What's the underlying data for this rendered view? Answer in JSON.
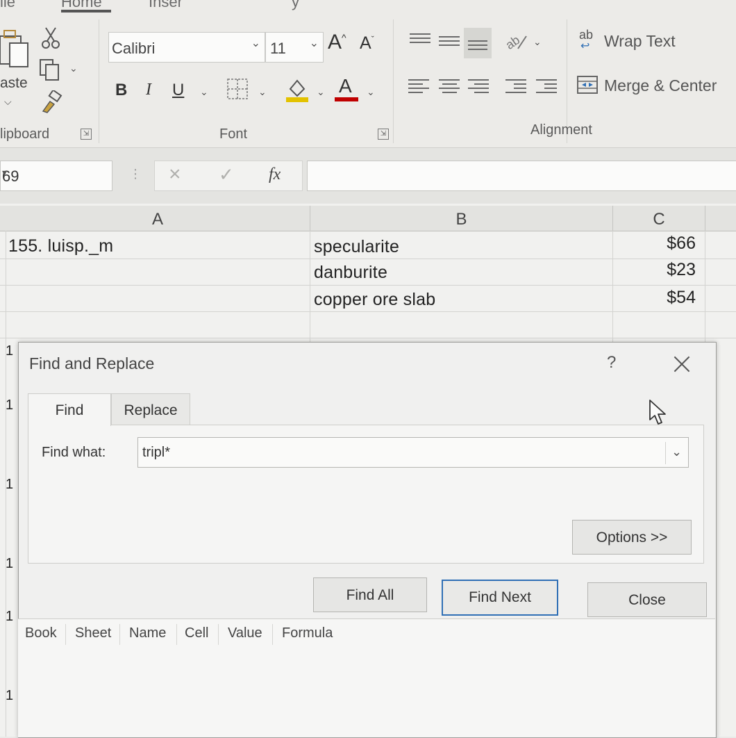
{
  "ribbon": {
    "tab_fragments": {
      "file": "ile",
      "home": "Home",
      "insert": "Inser",
      "other": "y"
    },
    "clipboard": {
      "paste_label": "aste",
      "group_label": "lipboard",
      "icons": [
        "paste-icon",
        "cut-icon",
        "copy-icon",
        "format-painter-icon"
      ]
    },
    "font": {
      "font_name": "Calibri",
      "font_size": "11",
      "grow_label": "A",
      "shrink_label": "A",
      "bold": "B",
      "italic": "I",
      "underline": "U",
      "font_color_label": "A",
      "group_label": "Font",
      "highlight_color": "#e3c200",
      "font_color": "#c00000"
    },
    "alignment": {
      "wrap_text": "Wrap Text",
      "wrap_icon_text": "ab",
      "merge_center": "Merge & Center",
      "group_label": "Alignment"
    }
  },
  "formula_bar": {
    "name_box": "69",
    "fx_label": "fx",
    "value": ""
  },
  "grid": {
    "columns": [
      "A",
      "B",
      "C"
    ],
    "rows": [
      {
        "a": "155. luisp._m",
        "b": "specularite",
        "c": "$66"
      },
      {
        "a": "",
        "b": "danburite",
        "c": "$23"
      },
      {
        "a": "",
        "b": "copper ore slab",
        "c": "$54"
      }
    ],
    "row_header_fragment": "1"
  },
  "dialog": {
    "title": "Find and Replace",
    "help": "?",
    "tabs": [
      {
        "label": "Find"
      },
      {
        "label": "Replace"
      }
    ],
    "find_what_label": "Find what:",
    "find_what_value": "tripl*",
    "buttons": {
      "options": "Options >>",
      "find_all": "Find All",
      "find_next": "Find Next",
      "close": "Close"
    },
    "results_columns": [
      "Book",
      "Sheet",
      "Name",
      "Cell",
      "Value",
      "Formula"
    ]
  }
}
